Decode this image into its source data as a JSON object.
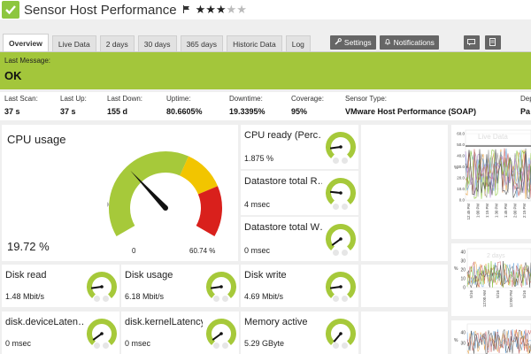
{
  "header": {
    "title": "Sensor Host Performance",
    "rating_filled": 3,
    "rating_total": 5,
    "icons": [
      "status-ok-check-icon",
      "flag-icon",
      "star-icon"
    ]
  },
  "tabs": [
    {
      "label": "Overview",
      "active": true
    },
    {
      "label": "Live Data"
    },
    {
      "label": "2 days"
    },
    {
      "label": "30 days"
    },
    {
      "label": "365 days"
    },
    {
      "label": "Historic Data"
    },
    {
      "label": "Log"
    }
  ],
  "toolbar": {
    "settings_label": "Settings",
    "notifications_label": "Notifications"
  },
  "last_message": {
    "label": "Last Message:",
    "text": "OK"
  },
  "stats": [
    {
      "label": "Last Scan:",
      "value": "37 s"
    },
    {
      "label": "Last Up:",
      "value": "37 s"
    },
    {
      "label": "Last Down:",
      "value": "155 d"
    },
    {
      "label": "Uptime:",
      "value": "80.6605%"
    },
    {
      "label": "Downtime:",
      "value": "19.3395%"
    },
    {
      "label": "Coverage:",
      "value": "95%"
    },
    {
      "label": "Sensor Type:",
      "value": "VMware Host Performance (SOAP)"
    },
    {
      "label": "Dep",
      "value": "Pa"
    }
  ],
  "cpu": {
    "title": "CPU usage",
    "value": "19.72 %",
    "min_label": "0",
    "max_label": "60.74 %",
    "needle_fraction": 0.32,
    "colors": {
      "ok": "#a6c93a",
      "warn": "#f2c500",
      "error": "#d9201c"
    }
  },
  "channels": [
    {
      "title": "CPU ready (Perc…",
      "value": "1.875 %",
      "needle": 0.15
    },
    {
      "title": "Datastore total R…",
      "value": "4 msec",
      "needle": 0.2
    },
    {
      "title": "Datastore total W…",
      "value": "0 msec",
      "needle": 0.05
    },
    {
      "title": "Disk read",
      "value": "1.48 Mbit/s",
      "needle": 0.15
    },
    {
      "title": "Disk usage",
      "value": "6.18 Mbit/s",
      "needle": 0.15
    },
    {
      "title": "Disk write",
      "value": "4.69 Mbit/s",
      "needle": 0.15
    },
    {
      "title": "disk.deviceLaten…",
      "value": "0 msec",
      "needle": 0.05
    },
    {
      "title": "disk.kernelLatency",
      "value": "0 msec",
      "needle": 0.05
    },
    {
      "title": "Memory active",
      "value": "5.29 GByte",
      "needle": 0.0
    }
  ],
  "charts": {
    "live_label": "Live Data",
    "twodays_label": "2 days",
    "ylabel": "%",
    "live_yticks": [
      "60.0",
      "50.0",
      "40.0",
      "30.0",
      "20.0",
      "10.0",
      "0.0"
    ],
    "live_xticks": [
      "12:45 PM",
      "1:00 PM",
      "1:15 PM",
      "1:30 PM",
      "1:45 PM",
      "2:00 PM",
      "2:15 PM"
    ],
    "twodays_yticks": [
      "40",
      "30",
      "20",
      "10",
      "0"
    ],
    "twodays_xticks": [
      "5/16",
      "12:00 AM",
      "5/16",
      "12:00 PM",
      "5/16"
    ],
    "third_yticks": [
      "40",
      "30"
    ]
  }
}
